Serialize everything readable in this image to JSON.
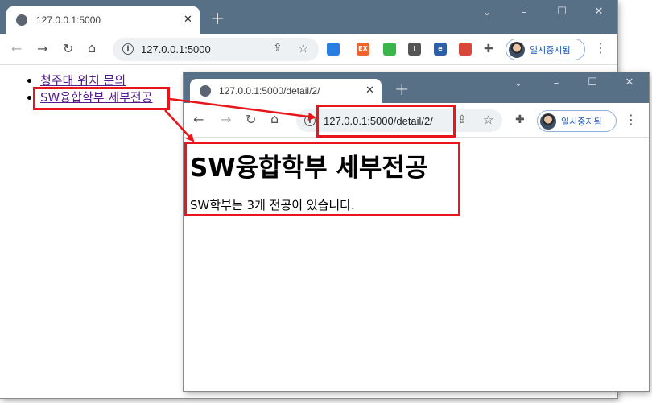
{
  "back_window": {
    "tab_title": "127.0.0.1:5000",
    "url": "127.0.0.1:5000",
    "profile_label": "일시중지됨",
    "extensions": [
      {
        "name": "layers-extension-icon",
        "color": "#2a7de1",
        "text": ""
      },
      {
        "name": "ex-extension-icon",
        "color": "#f0632a",
        "text": "EX"
      },
      {
        "name": "monitor-extension-icon",
        "color": "#3ab54a",
        "text": ""
      },
      {
        "name": "dark-extension-icon",
        "color": "#555555",
        "text": "I"
      },
      {
        "name": "edge-extension-icon",
        "color": "#2d5fa8",
        "text": "e"
      },
      {
        "name": "screen-extension-icon",
        "color": "#d8473a",
        "text": ""
      }
    ],
    "links": [
      {
        "label": "청주대 위치 문의"
      },
      {
        "label": "SW융합학부 세부전공"
      }
    ]
  },
  "front_window": {
    "tab_title": "127.0.0.1:5000/detail/2/",
    "url": "127.0.0.1:5000/detail/2/",
    "profile_label": "일시중지됨",
    "heading": "SW융합학부 세부전공",
    "body_text": "SW학부는 3개 전공이 있습니다."
  },
  "annotation": {
    "color": "#e8161a"
  }
}
